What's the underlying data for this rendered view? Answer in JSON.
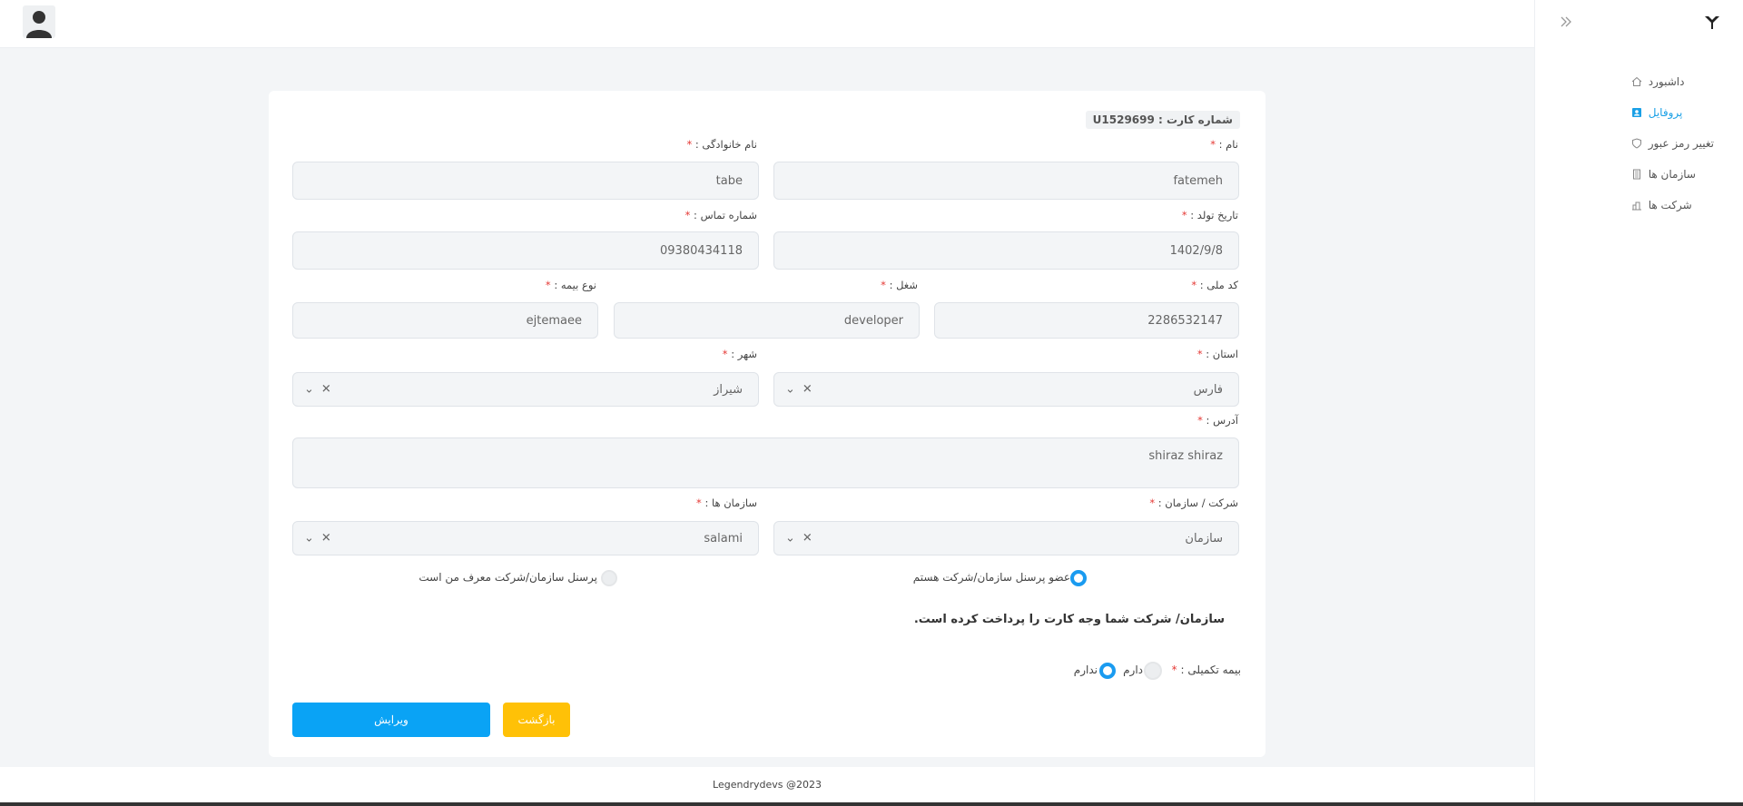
{
  "sidebar": {
    "items": [
      {
        "label": "داشبورد",
        "icon": "home-icon"
      },
      {
        "label": "پروفایل",
        "icon": "profile-icon"
      },
      {
        "label": "تغییر رمز عبور",
        "icon": "shield-icon"
      },
      {
        "label": "سازمان ها",
        "icon": "building-icon"
      },
      {
        "label": "شرکت ها",
        "icon": "company-icon"
      }
    ],
    "active_item": "پروفایل"
  },
  "card": {
    "card_number": "شماره کارت : U1529699"
  },
  "form": {
    "first_name": {
      "label": "نام :",
      "value": "fatemeh"
    },
    "last_name": {
      "label": "نام خانوادگی :",
      "value": "tabe"
    },
    "birth_date": {
      "label": "تاریخ تولد :",
      "value": "1402/9/8"
    },
    "phone": {
      "label": "شماره تماس :",
      "value": "09380434118"
    },
    "national_code": {
      "label": "کد ملی :",
      "value": "2286532147"
    },
    "job": {
      "label": "شغل :",
      "value": "developer"
    },
    "insurance_type": {
      "label": "نوع بیمه :",
      "value": "ejtemaee"
    },
    "province": {
      "label": "استان :",
      "value": "فارس"
    },
    "city": {
      "label": "شهر :",
      "value": "شیراز"
    },
    "address": {
      "label": "آدرس :",
      "value": "shiraz shiraz"
    },
    "company_org": {
      "label": "شرکت / سازمان :",
      "value": "سازمان"
    },
    "organizations": {
      "label": "سازمان ها :",
      "value": "salami"
    },
    "required_mark": "*",
    "clear_glyph": "✕",
    "chevron_glyph": "⌄"
  },
  "membership": {
    "option_member": "عضو پرسنل سازمان/شرکت هستم",
    "option_referrer": "پرسنل سازمان/شرکت معرف من است",
    "selected": "option_member"
  },
  "notice": "سازمان/ شرکت شما وجه کارت را پرداخت کرده است.",
  "supplementary_insurance": {
    "label": "بیمه تکمیلی :",
    "option_yes": "دارم",
    "option_no": "ندارم",
    "selected": "option_no"
  },
  "buttons": {
    "edit": "ویرایش",
    "back": "بازگشت"
  },
  "footer": "Legendrydevs @2023",
  "colors": {
    "accent": "#0aa3f5",
    "back_button": "#ffc107",
    "required": "#e53935",
    "active_menu": "#1aa0e6"
  }
}
